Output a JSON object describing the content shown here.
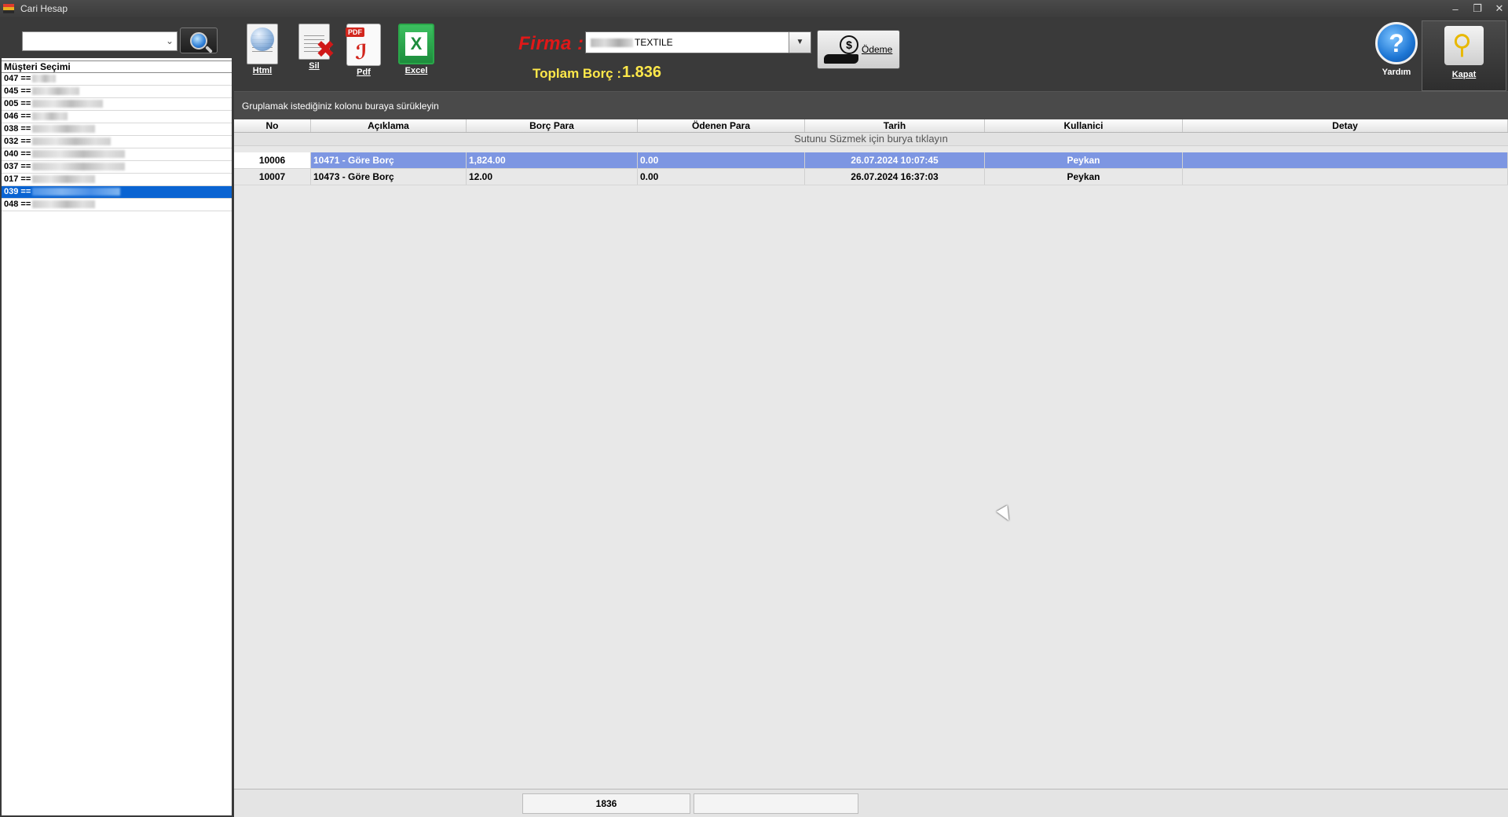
{
  "window": {
    "title": "Cari Hesap"
  },
  "left": {
    "list_header": "Müşteri Seçimi",
    "customers": [
      {
        "code": "047 ==",
        "blur_w": 30
      },
      {
        "code": "045 ==",
        "blur_w": 60
      },
      {
        "code": "005 ==",
        "blur_w": 90
      },
      {
        "code": "046 ==",
        "blur_w": 45
      },
      {
        "code": "038 ==",
        "blur_w": 80
      },
      {
        "code": "032 ==",
        "blur_w": 100
      },
      {
        "code": "040 ==",
        "blur_w": 118
      },
      {
        "code": "037 ==",
        "blur_w": 118
      },
      {
        "code": "017 ==",
        "blur_w": 80
      },
      {
        "code": "039 ==",
        "blur_w": 112
      },
      {
        "code": "048 ==",
        "blur_w": 80
      }
    ],
    "selected_index": 9
  },
  "toolbar": {
    "html_label": "Html",
    "sil_label": "Sil",
    "pdf_label": "Pdf",
    "pdf_tag": "PDF",
    "excel_label": "Excel",
    "firma_label": "Firma :",
    "firma_value": "TEXTILE",
    "odeme_label": "Ödeme",
    "toplam_borc_label": "Toplam Borç :",
    "toplam_borc_value": "1.836",
    "yardim_label": "Yardım",
    "kapat_label": "Kapat"
  },
  "grid": {
    "group_hint": "Gruplamak istediğiniz kolonu buraya sürükleyin",
    "filter_hint": "Sutunu Süzmek için burya tıklayın",
    "columns": [
      "No",
      "Açıklama",
      "Borç Para",
      "Ödenen Para",
      "Tarih",
      "Kullanici",
      "Detay"
    ],
    "rows": [
      {
        "no": "10006",
        "aciklama": "10471 - Göre Borç",
        "borc": "1,824.00",
        "odenen": "0.00",
        "tarih": "26.07.2024 10:07:45",
        "kullanici": "Peykan",
        "detay": ""
      },
      {
        "no": "10007",
        "aciklama": "10473 - Göre Borç",
        "borc": "12.00",
        "odenen": "0.00",
        "tarih": "26.07.2024 16:37:03",
        "kullanici": "Peykan",
        "detay": ""
      }
    ],
    "footer_borc_total": "1836",
    "footer_odenen_total": ""
  },
  "colors": {
    "accent_selection": "#0a64d2",
    "row_selection": "#7d96e2",
    "firma_red": "#e01818",
    "borc_yellow": "#ffe84a"
  }
}
